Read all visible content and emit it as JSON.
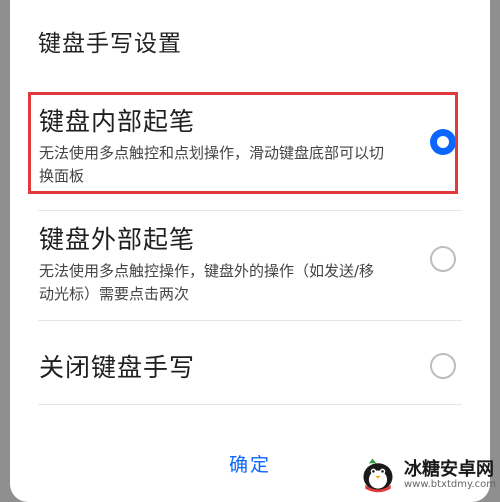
{
  "dialog": {
    "title": "键盘手写设置",
    "options": [
      {
        "title": "键盘内部起笔",
        "description": "无法使用多点触控和点划操作，滑动键盘底部可以切换面板",
        "selected": true
      },
      {
        "title": "键盘外部起笔",
        "description": "无法使用多点触控操作，键盘外的操作（如发送/移动光标）需要点击两次",
        "selected": false
      },
      {
        "title": "关闭键盘手写",
        "selected": false
      }
    ],
    "confirm_label": "确定"
  },
  "colors": {
    "accent": "#0a66ff",
    "highlight": "#e23a3a",
    "backdrop": "#8f8f8f"
  },
  "watermark": {
    "name": "冰糖安卓网",
    "url": "www.btxtdmy.com",
    "icon": "penguin-logo-icon"
  }
}
